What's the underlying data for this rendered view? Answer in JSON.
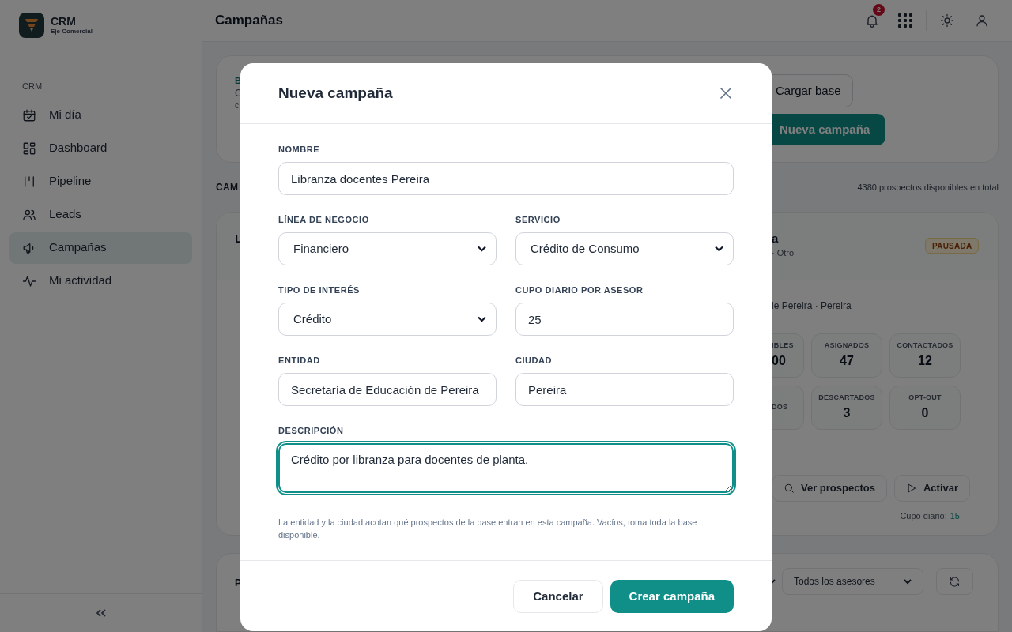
{
  "sidebar": {
    "brand": {
      "name": "CRM",
      "subtitle": "Eje Comercial"
    },
    "section": "CRM",
    "items": [
      {
        "label": "Mi día",
        "selected": false
      },
      {
        "label": "Dashboard",
        "selected": false
      },
      {
        "label": "Pipeline",
        "selected": false
      },
      {
        "label": "Leads",
        "selected": false
      },
      {
        "label": "Campañas",
        "selected": true
      },
      {
        "label": "Mi actividad",
        "selected": false
      }
    ]
  },
  "header": {
    "title": "Campañas",
    "notifications": "2"
  },
  "hero_card": {
    "fragments": [
      {
        "text": "B",
        "kind": "eyebrow"
      },
      {
        "text": "C",
        "kind": "text"
      },
      {
        "text": "c",
        "kind": "small"
      }
    ],
    "buttons": [
      {
        "label": "Cargar base",
        "kind": "outline"
      },
      {
        "label": "Nueva campaña",
        "kind": "primary"
      }
    ]
  },
  "campaigns_heading": "CAM",
  "total": "4380 prospectos disponibles en total",
  "campaign_card": {
    "title_left": "L",
    "title_right": "a",
    "subtitle_right": "· Otro",
    "status": "PAUSADA",
    "location": "le Pereira · Pereira",
    "stats": [
      {
        "label": "IBLES",
        "value": "00",
        "partial": true
      },
      {
        "label": "ASIGNADOS",
        "value": "47",
        "partial": false
      },
      {
        "label": "CONTACTADOS",
        "value": "12",
        "partial": false
      },
      {
        "label": "DOS",
        "partial": true
      },
      {
        "label": "DESCARTADOS",
        "value": "3",
        "partial": false
      },
      {
        "label": "OPT-OUT",
        "value": "0",
        "partial": false
      }
    ],
    "actions": [
      {
        "label": "Ver prospectos"
      },
      {
        "label": "Activar"
      }
    ],
    "quota_label": "Cupo diario:",
    "quota_value": "15"
  },
  "filters_card": {
    "fragment": "P",
    "select": "Todos los asesores"
  },
  "modal": {
    "title": "Nueva campaña",
    "fields": [
      {
        "label": "NOMBRE",
        "kind": "text",
        "value": "Libranza docentes Pereira",
        "wide": true
      },
      {
        "label": "LÍNEA DE NEGOCIO",
        "kind": "select",
        "value": "Financiero"
      },
      {
        "label": "SERVICIO",
        "kind": "select",
        "value": "Crédito de Consumo"
      },
      {
        "label": "TIPO DE INTERÉS",
        "kind": "select",
        "value": "Crédito"
      },
      {
        "label": "CUPO DIARIO POR ASESOR",
        "kind": "text",
        "value": "25"
      },
      {
        "label": "ENTIDAD",
        "kind": "text",
        "value": "Secretaría de Educación de Pereira"
      },
      {
        "label": "CIUDAD",
        "kind": "text",
        "value": "Pereira"
      },
      {
        "label": "DESCRIPCIÓN",
        "kind": "textarea",
        "value": "Crédito por libranza para docentes de planta.",
        "wide": true,
        "focused": true
      }
    ],
    "hint": "La entidad y la ciudad acotan qué prospectos de la base entran en esta campaña. Vacíos, toma toda la base disponible.",
    "buttons": [
      {
        "label": "Cancelar",
        "kind": "outline"
      },
      {
        "label": "Crear campaña",
        "kind": "primary"
      }
    ]
  }
}
